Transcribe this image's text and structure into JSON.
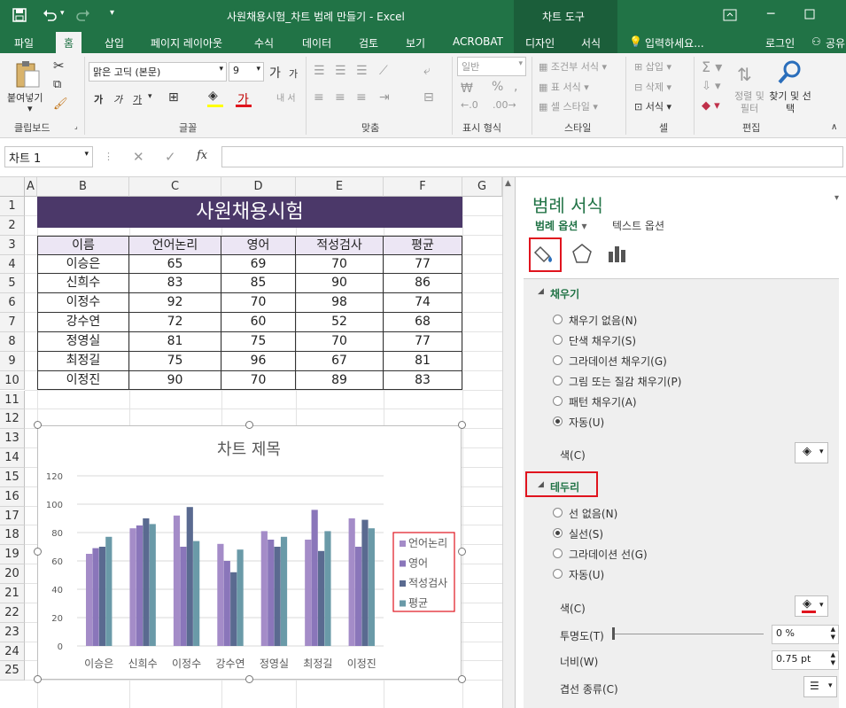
{
  "window": {
    "title": "사원채용시험_차트 범례 만들기 - Excel",
    "context_tools": "차트 도구"
  },
  "tabs": [
    "파일",
    "홈",
    "삽입",
    "페이지 레이아웃",
    "수식",
    "데이터",
    "검토",
    "보기",
    "ACROBAT",
    "디자인",
    "서식"
  ],
  "tell_me": "입력하세요...",
  "login": "로그인",
  "share": "공유",
  "ribbon": {
    "paste": "붙여넣기",
    "clipboard": "클립보드",
    "font_name": "맑은 고딕 (본문)",
    "font_size": "9",
    "font_group": "글꼴",
    "align_group": "맞춤",
    "number_format": "일반",
    "number_group": "표시 형식",
    "cond_format": "조건부 서식",
    "table_format": "표 서식",
    "cell_style": "셀 스타일",
    "style_group": "스타일",
    "insert": "삽입",
    "delete": "삭제",
    "format": "서식",
    "cells_group": "셀",
    "sort_filter": "정렬 및 필터",
    "find_select": "찾기 및 선택",
    "edit_group": "편집",
    "wrap": "내 서"
  },
  "name_box": "차트 1",
  "fx": "fx",
  "sheet": {
    "columns": [
      "A",
      "B",
      "C",
      "D",
      "E",
      "F",
      "G"
    ],
    "rows": [
      "1",
      "2",
      "3",
      "4",
      "5",
      "6",
      "7",
      "8",
      "9",
      "10",
      "11",
      "12",
      "13",
      "14",
      "15",
      "16",
      "17",
      "18",
      "19",
      "20",
      "21",
      "22",
      "23",
      "24",
      "25"
    ],
    "title": "사원채용시험",
    "headers": [
      "이름",
      "언어논리",
      "영어",
      "적성검사",
      "평균"
    ],
    "data": [
      [
        "이승은",
        "65",
        "69",
        "70",
        "77"
      ],
      [
        "신희수",
        "83",
        "85",
        "90",
        "86"
      ],
      [
        "이정수",
        "92",
        "70",
        "98",
        "74"
      ],
      [
        "강수연",
        "72",
        "60",
        "52",
        "68"
      ],
      [
        "정영실",
        "81",
        "75",
        "70",
        "77"
      ],
      [
        "최정길",
        "75",
        "96",
        "67",
        "81"
      ],
      [
        "이정진",
        "90",
        "70",
        "89",
        "83"
      ]
    ]
  },
  "chart_data": {
    "type": "bar",
    "title": "차트 제목",
    "categories": [
      "이승은",
      "신희수",
      "이정수",
      "강수연",
      "정영실",
      "최정길",
      "이정진"
    ],
    "series": [
      {
        "name": "언어논리",
        "values": [
          65,
          83,
          92,
          72,
          81,
          75,
          90
        ],
        "color": "#a48cc8"
      },
      {
        "name": "영어",
        "values": [
          69,
          85,
          70,
          60,
          75,
          96,
          70
        ],
        "color": "#8a76ba"
      },
      {
        "name": "적성검사",
        "values": [
          70,
          90,
          98,
          52,
          70,
          67,
          89
        ],
        "color": "#5a6a90"
      },
      {
        "name": "평균",
        "values": [
          77,
          86,
          74,
          68,
          77,
          81,
          83
        ],
        "color": "#6a9aa8"
      }
    ],
    "yticks": [
      "0",
      "20",
      "40",
      "60",
      "80",
      "100",
      "120"
    ],
    "ylim": [
      0,
      120
    ],
    "grid": true,
    "legend": "right"
  },
  "pane": {
    "title": "범례 서식",
    "legend_options": "범례 옵션",
    "text_options": "텍스트 옵션",
    "fill_section": "채우기",
    "fill_options": [
      "채우기 없음(N)",
      "단색 채우기(S)",
      "그라데이션 채우기(G)",
      "그림 또는 질감 채우기(P)",
      "패턴 채우기(A)",
      "자동(U)"
    ],
    "fill_selected": 5,
    "color_label": "색(C)",
    "border_section": "테두리",
    "border_options": [
      "선 없음(N)",
      "실선(S)",
      "그라데이션 선(G)",
      "자동(U)"
    ],
    "border_selected": 1,
    "border_color_label": "색(C)",
    "transparency_label": "투명도(T)",
    "transparency_value": "0 %",
    "width_label": "너비(W)",
    "width_value": "0.75 pt",
    "compound_label": "겹선 종류(C)"
  },
  "colors": {
    "excel_green": "#217346",
    "header_purple": "#4b3869",
    "header_fill": "#ece6f4",
    "highlight_red": "#e0141e"
  }
}
